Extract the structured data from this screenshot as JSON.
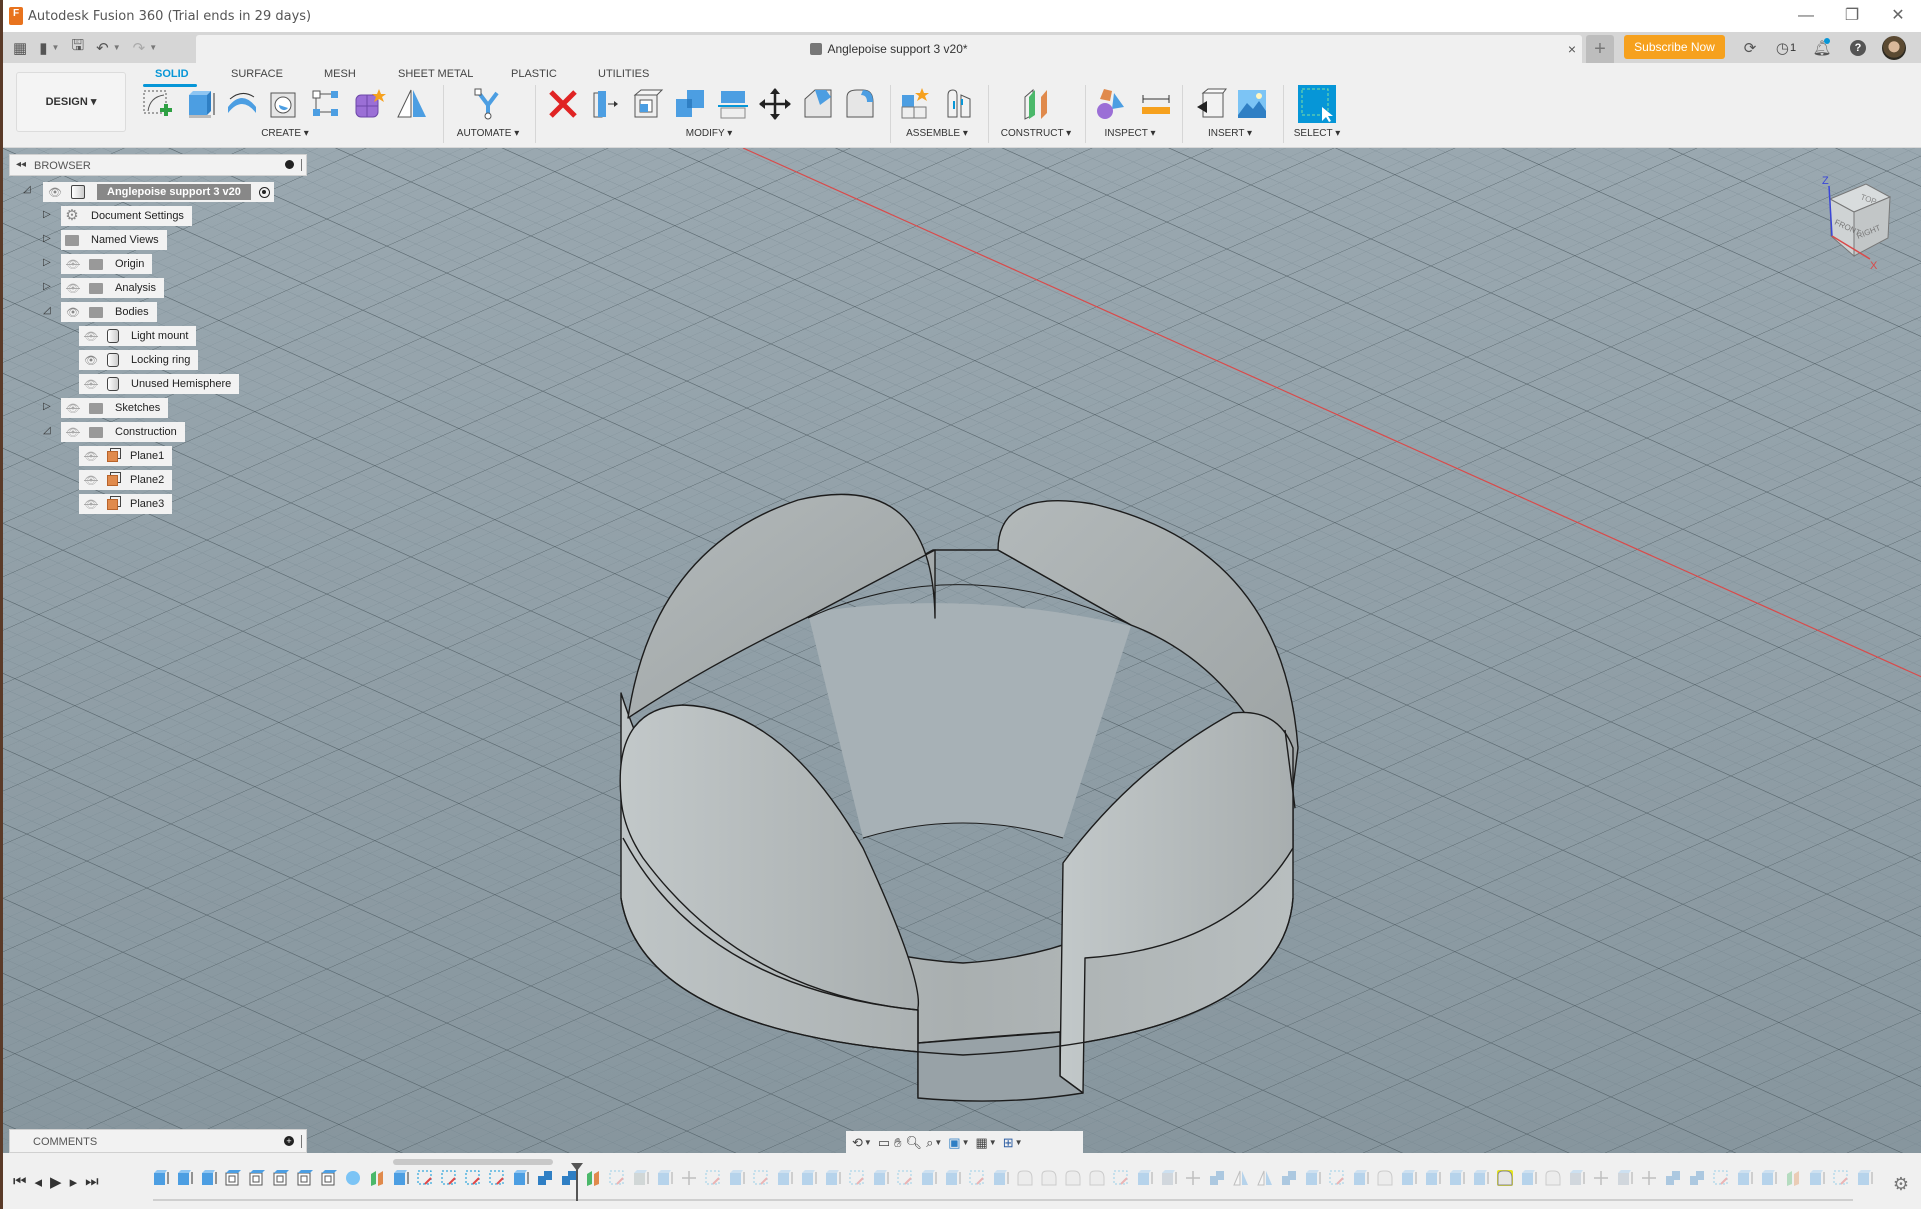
{
  "window": {
    "title": "Autodesk Fusion 360 (Trial ends in 29 days)",
    "controls": [
      "minimize",
      "restore",
      "close"
    ]
  },
  "quick_access": {
    "icons": [
      "grid-menu-icon",
      "file-icon",
      "save-icon",
      "undo-icon",
      "redo-icon"
    ]
  },
  "document_tab": {
    "title": "Anglepoise support 3 v20*",
    "close_label": "×",
    "new_tab_label": "+"
  },
  "header_right": {
    "subscribe_label": "Subscribe Now",
    "job_count": "1",
    "subscribe_color": "#f6a11e"
  },
  "ribbon": {
    "workspace_label": "DESIGN ▾",
    "tabs": [
      {
        "label": "SOLID",
        "active": true
      },
      {
        "label": "SURFACE",
        "active": false
      },
      {
        "label": "MESH",
        "active": false
      },
      {
        "label": "SHEET METAL",
        "active": false
      },
      {
        "label": "PLASTIC",
        "active": false
      },
      {
        "label": "UTILITIES",
        "active": false
      }
    ],
    "groups": [
      {
        "label": "CREATE ▾",
        "tools": [
          "create-sketch",
          "extrude",
          "revolve",
          "hole",
          "rectangular-pattern",
          "create-form",
          "mirror"
        ]
      },
      {
        "label": "AUTOMATE ▾",
        "tools": [
          "automated-modeling"
        ]
      },
      {
        "label": "MODIFY ▾",
        "tools": [
          "delete",
          "press-pull",
          "shell",
          "combine",
          "split-body",
          "move-copy",
          "chamfer",
          "fillet"
        ]
      },
      {
        "label": "ASSEMBLE ▾",
        "tools": [
          "new-component",
          "joint"
        ]
      },
      {
        "label": "CONSTRUCT ▾",
        "tools": [
          "offset-plane"
        ]
      },
      {
        "label": "INSPECT ▾",
        "tools": [
          "section-analysis",
          "measure"
        ]
      },
      {
        "label": "INSERT ▾",
        "tools": [
          "insert-derive",
          "insert-canvas"
        ]
      },
      {
        "label": "SELECT ▾",
        "tools": [
          "select"
        ]
      }
    ],
    "accent_color": "#0696d7"
  },
  "browser": {
    "title": "BROWSER",
    "root": {
      "label": "Anglepoise support 3 v20"
    },
    "items": [
      {
        "label": "Document Settings",
        "icon": "gear",
        "eye": null,
        "expanded": false,
        "level": 1
      },
      {
        "label": "Named Views",
        "icon": "folder",
        "eye": null,
        "expanded": false,
        "level": 1
      },
      {
        "label": "Origin",
        "icon": "folder",
        "eye": "hidden",
        "expanded": false,
        "level": 1
      },
      {
        "label": "Analysis",
        "icon": "folder",
        "eye": "hidden",
        "expanded": false,
        "level": 1
      },
      {
        "label": "Bodies",
        "icon": "folder",
        "eye": "visible",
        "expanded": true,
        "level": 1
      },
      {
        "label": "Light mount",
        "icon": "body",
        "eye": "hidden",
        "level": 2
      },
      {
        "label": "Locking ring",
        "icon": "body",
        "eye": "visible",
        "level": 2
      },
      {
        "label": "Unused Hemisphere",
        "icon": "body",
        "eye": "hidden",
        "level": 2
      },
      {
        "label": "Sketches",
        "icon": "folder",
        "eye": "hidden",
        "expanded": false,
        "level": 1
      },
      {
        "label": "Construction",
        "icon": "folder",
        "eye": "hidden",
        "expanded": true,
        "level": 1
      },
      {
        "label": "Plane1",
        "icon": "plane",
        "eye": "hidden",
        "level": 2
      },
      {
        "label": "Plane2",
        "icon": "plane",
        "eye": "hidden",
        "level": 2
      },
      {
        "label": "Plane3",
        "icon": "plane",
        "eye": "hidden",
        "level": 2
      }
    ]
  },
  "comments": {
    "title": "COMMENTS"
  },
  "viewcube": {
    "faces": {
      "top": "TOP",
      "front": "FRONT",
      "right": "RIGHT"
    },
    "axes": {
      "z": "Z",
      "x": "X"
    }
  },
  "navbar": {
    "tools": [
      "orbit",
      "look-at",
      "pan",
      "zoom",
      "fit",
      "display-settings",
      "grid-snaps",
      "viewports"
    ]
  },
  "timeline": {
    "controls": [
      "go-to-start",
      "step-back",
      "play",
      "step-forward",
      "go-to-end"
    ],
    "features": [
      "extrude",
      "extrude",
      "extrude",
      "shell",
      "shell",
      "shell",
      "shell",
      "shell",
      "sphere",
      "plane",
      "split",
      "sketch",
      "sketch",
      "sketch",
      "sketch",
      "extrude",
      "combine",
      "combine",
      "plane",
      "sketch",
      "revolve",
      "split",
      "move",
      "sketch",
      "extrude",
      "sketch",
      "extrude",
      "extrude",
      "extrude",
      "sketch",
      "extrude",
      "sketch",
      "extrude",
      "extrude",
      "sketch",
      "extrude",
      "fillet",
      "fillet",
      "fillet",
      "fillet",
      "sketch",
      "extrude",
      "joint",
      "move",
      "combine",
      "mirror",
      "mirror",
      "combine",
      "extrude",
      "sketch",
      "extrude",
      "fillet",
      "extrude",
      "extrude",
      "extrude",
      "extrude",
      "fillet",
      "extrude",
      "fillet",
      "joint",
      "move",
      "joint",
      "move",
      "combine",
      "combine",
      "sketch",
      "extrude",
      "extrude",
      "plane",
      "split",
      "sketch",
      "extrude"
    ],
    "marker_index": 18,
    "highlight_index": 56,
    "highlight_color": "#e6e619"
  }
}
